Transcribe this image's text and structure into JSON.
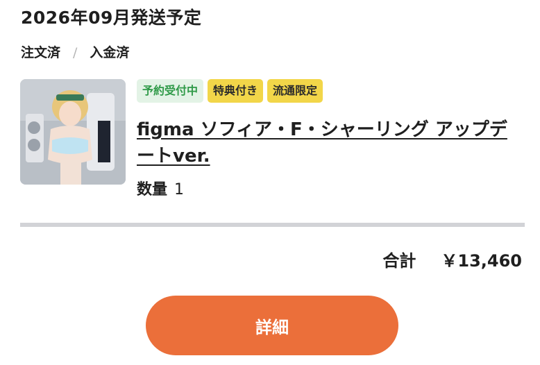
{
  "order": {
    "ship_date": "2026年09月発送予定",
    "status_order": "注文済",
    "status_separator": "/",
    "status_payment": "入金済"
  },
  "item": {
    "badges": [
      "予約受付中",
      "特典付き",
      "流通限定"
    ],
    "name": "figma ソフィア・F・シャーリング アップデートver.",
    "quantity_label": "数量",
    "quantity_value": "1"
  },
  "summary": {
    "total_label": "合計",
    "total_value": "￥13,460"
  },
  "actions": {
    "detail_label": "詳細"
  },
  "colors": {
    "accent": "#eb6f3a",
    "badge_green_bg": "#e3f3e6",
    "badge_green_text": "#2f9a48",
    "badge_yellow_bg": "#f2d649"
  }
}
